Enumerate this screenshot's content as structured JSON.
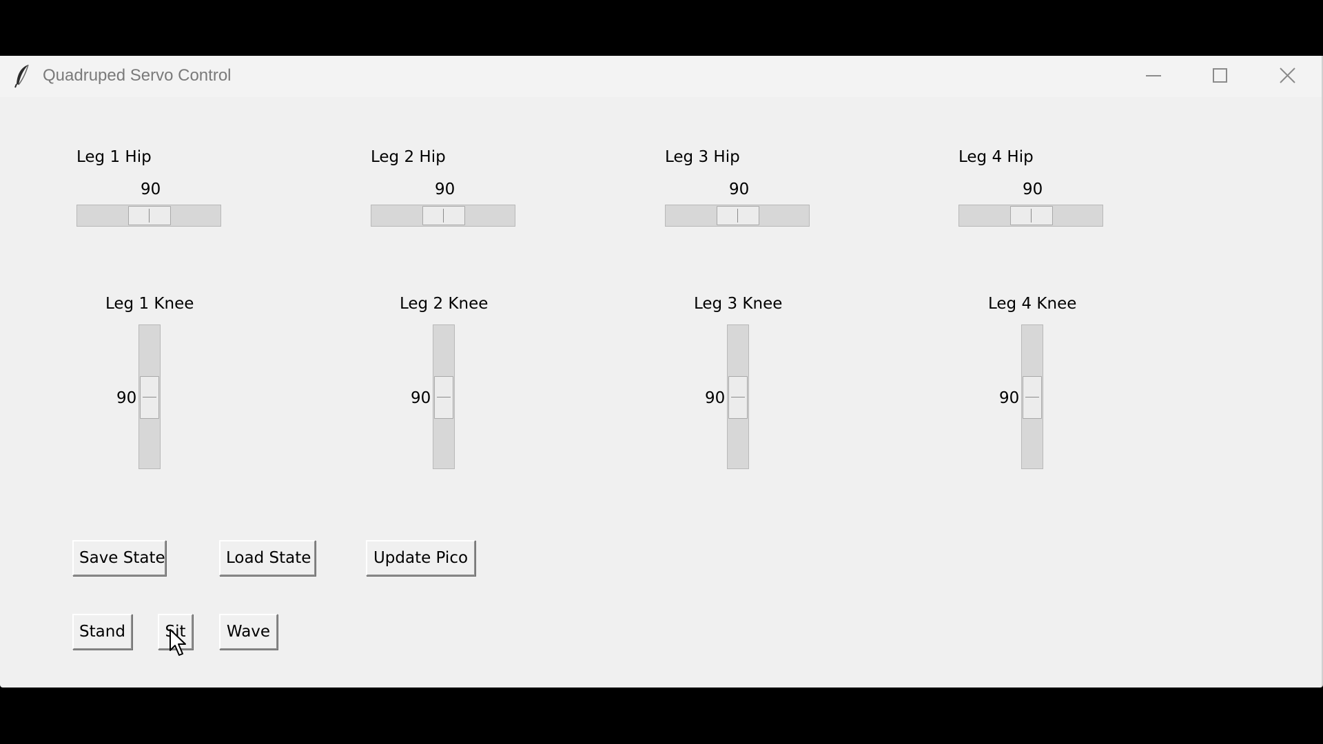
{
  "window": {
    "title": "Quadruped Servo Control",
    "app_icon": "feather-icon",
    "controls": [
      "minimize-icon",
      "maximize-icon",
      "close-icon"
    ]
  },
  "hips": [
    {
      "label": "Leg 1 Hip",
      "value": "90"
    },
    {
      "label": "Leg 2 Hip",
      "value": "90"
    },
    {
      "label": "Leg 3 Hip",
      "value": "90"
    },
    {
      "label": "Leg 4 Hip",
      "value": "90"
    }
  ],
  "knees": [
    {
      "label": "Leg 1 Knee",
      "value": "90"
    },
    {
      "label": "Leg 2 Knee",
      "value": "90"
    },
    {
      "label": "Leg 3 Knee",
      "value": "90"
    },
    {
      "label": "Leg 4 Knee",
      "value": "90"
    }
  ],
  "buttons": {
    "save_state": "Save State",
    "load_state": "Load State",
    "update_pico": "Update Pico",
    "stand": "Stand",
    "sit": "Sit",
    "wave": "Wave"
  },
  "colors": {
    "window_bg": "#f0f0f0",
    "outer_bg": "#000000",
    "slider_trough": "#d7d7d7"
  }
}
